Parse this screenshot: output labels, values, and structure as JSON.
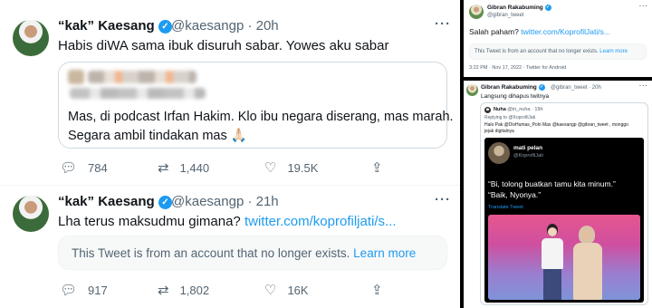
{
  "left": {
    "tweet1": {
      "display_name": "“kak” Kaesang",
      "handle": "@kaesangp",
      "time": "20h",
      "text": "Habis diWA sama ibuk disuruh sabar. Yowes aku sabar",
      "quote_line1": "Mas, di podcast Irfan Hakim. Klo ibu negara diserang, mas marah.",
      "quote_line2": "Segara ambil tindakan mas 🙏🏻",
      "replies": "784",
      "retweets": "1,440",
      "likes": "19.5K"
    },
    "tweet2": {
      "display_name": "“kak” Kaesang",
      "handle": "@kaesangp",
      "time": "21h",
      "text": "Lha terus maksudmu gimana?",
      "link": "twitter.com/koprofiljati/s...",
      "unavailable": "This Tweet is from an account that no longer exists.",
      "learn_more": "Learn more",
      "replies": "917",
      "retweets": "1,802",
      "likes": "16K"
    }
  },
  "right_top": {
    "display_name": "Gibran Rakabuming",
    "handle": "@gibran_tweet",
    "text": "Salah paham?",
    "link": "twitter.com/KoprofilJati/s...",
    "unavailable": "This Tweet is from an account that no longer exists.",
    "learn_more": "Learn more",
    "meta": "3:22 PM · Nov 17, 2022 · Twitter for Android"
  },
  "right_bottom": {
    "display_name": "Gibran Rakabuming",
    "handle": "@gibran_tweet",
    "time": "20h",
    "text": "Langsung dihapus twitnya",
    "quote": {
      "display_name": "Nuha",
      "handle": "@iri_nuha",
      "time": "19h",
      "replying_to": "Replying to @KoprofilJati",
      "text_line1": "Halo Pak @DivHumas_Polri Mas @kaesangp @gibran_tweet , monggo",
      "text_line2": "jejak digitalnya"
    },
    "embed": {
      "display_name": "mati pelan",
      "handle": "@KoprofilJati",
      "line1": "“Bi, tolong buatkan tamu kita minum.”",
      "line2": "“Baik, Nyonya.”",
      "translate": "Translate Tweet"
    }
  },
  "icons": {
    "reply": "reply-icon",
    "retweet": "retweet-icon",
    "like": "heart-icon",
    "share": "share-icon",
    "verified": "verified-badge-icon",
    "more": "more-icon"
  },
  "colors": {
    "link": "#1d9bf0",
    "verified": "#1d9bf0",
    "muted": "#536471",
    "divider": "#000000"
  }
}
